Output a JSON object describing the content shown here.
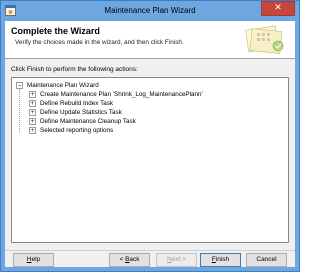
{
  "window": {
    "title": "Maintenance Plan Wizard",
    "close_glyph": "✕",
    "app_icon": "wizard-app-icon"
  },
  "header": {
    "title": "Complete the Wizard",
    "subtitle": "Verify the choices made in the wizard, and then click Finish.",
    "graphic": "wizard-banner-graphic"
  },
  "instruction": "Click Finish to perform the following actions:",
  "tree": {
    "root": {
      "label": "Maintenance Plan Wizard",
      "expander": "−"
    },
    "items": [
      {
        "label": "Create Maintenance Plan 'Shrink_Log_MaintenancePlann'",
        "expander": "+"
      },
      {
        "label": "Define Rebuild Index Task",
        "expander": "+"
      },
      {
        "label": "Define Update Statistics Task",
        "expander": "+"
      },
      {
        "label": "Define Maintenance Cleanup Task",
        "expander": "+"
      },
      {
        "label": "Selected reporting options",
        "expander": "+"
      }
    ]
  },
  "buttons": {
    "help": {
      "prefix": "",
      "key": "H",
      "suffix": "elp"
    },
    "back": {
      "prefix": "< ",
      "key": "B",
      "suffix": "ack"
    },
    "next": {
      "prefix": "",
      "key": "N",
      "suffix": "ext >"
    },
    "finish": {
      "prefix": "",
      "key": "F",
      "suffix": "inish"
    },
    "cancel": {
      "label": "Cancel"
    }
  },
  "colors": {
    "frame": "#6ea6e0",
    "close_button": "#c7463c",
    "dialog_background": "#f0f0f0"
  }
}
